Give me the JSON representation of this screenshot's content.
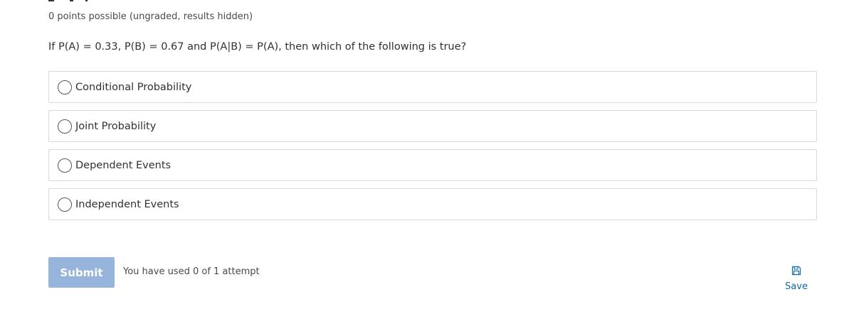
{
  "problem": {
    "points_text": "0 points possible (ungraded, results hidden)",
    "question": "If P(A) = 0.33, P(B) = 0.67 and P(A|B) = P(A), then which of the following is true?",
    "options": [
      {
        "label": "Conditional Probability",
        "selected": false
      },
      {
        "label": "Joint Probability",
        "selected": false
      },
      {
        "label": "Dependent Events",
        "selected": false
      },
      {
        "label": "Independent Events",
        "selected": false
      }
    ]
  },
  "actions": {
    "submit_label": "Submit",
    "submit_enabled": false,
    "attempts_text": "You have used 0 of 1 attempt",
    "save_label": "Save",
    "save_icon": "floppy-disk-icon"
  },
  "colors": {
    "submit_disabled_bg": "#97b4dc",
    "link": "#0e6aa8",
    "option_border": "#d9d9d9"
  }
}
